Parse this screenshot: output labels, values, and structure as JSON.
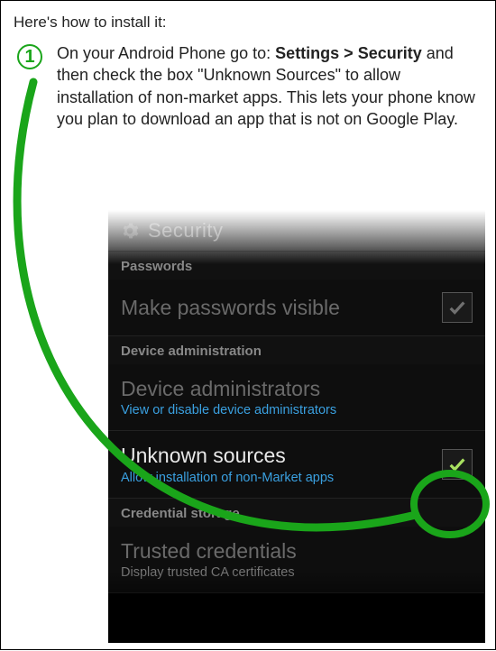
{
  "heading": "Here's how to install it:",
  "step": {
    "number": "1",
    "text_before": "On your Android Phone go to: ",
    "bold": "Settings > Security",
    "text_after": " and then check the box \"Unknown Sources\" to allow installation of non-market apps. This lets your phone know you plan to download an app that is not on Google Play."
  },
  "phone": {
    "header_title": "Security",
    "sections": {
      "passwords": {
        "label": "Passwords",
        "row_title": "Make passwords visible"
      },
      "device_admin": {
        "label": "Device administration",
        "row1_title": "Device administrators",
        "row1_sub": "View or disable device administrators",
        "row2_title": "Unknown sources",
        "row2_sub": "Allow installation of non-Market apps"
      },
      "credential": {
        "label": "Credential storage",
        "row_title": "Trusted credentials",
        "row_sub": "Display trusted CA certificates"
      }
    }
  }
}
